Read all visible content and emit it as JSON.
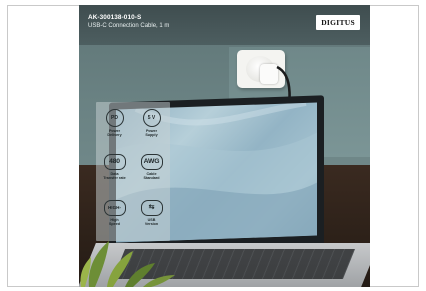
{
  "header": {
    "sku": "AK-300138-010-S",
    "subtitle": "USB-C Connection Cable, 1 m",
    "brand": "DIGITUS"
  },
  "features": [
    {
      "badge": "PD",
      "badge_sub": "60W",
      "label_1": "Power",
      "label_2": "Delivery"
    },
    {
      "badge": "5 V",
      "badge_sub": "3 A",
      "label_1": "Power",
      "label_2": "Supply"
    },
    {
      "badge": "480",
      "badge_sub": "Mbps",
      "label_1": "Data",
      "label_2": "Transfer rate"
    },
    {
      "badge": "AWG",
      "badge_sub": "24/28",
      "label_1": "Cable",
      "label_2": "Standard"
    },
    {
      "badge": "HIGH-",
      "badge_sub": "SPEED",
      "label_1": "High",
      "label_2": "Speed"
    },
    {
      "badge": "⇆",
      "badge_sub": "USB-C",
      "label_1": "USB",
      "label_2": "Version"
    }
  ],
  "colors": {
    "wall": "#6f8788",
    "topbar": "#46575a",
    "desk": "#2d2119",
    "panel": "#c8d2d3"
  }
}
